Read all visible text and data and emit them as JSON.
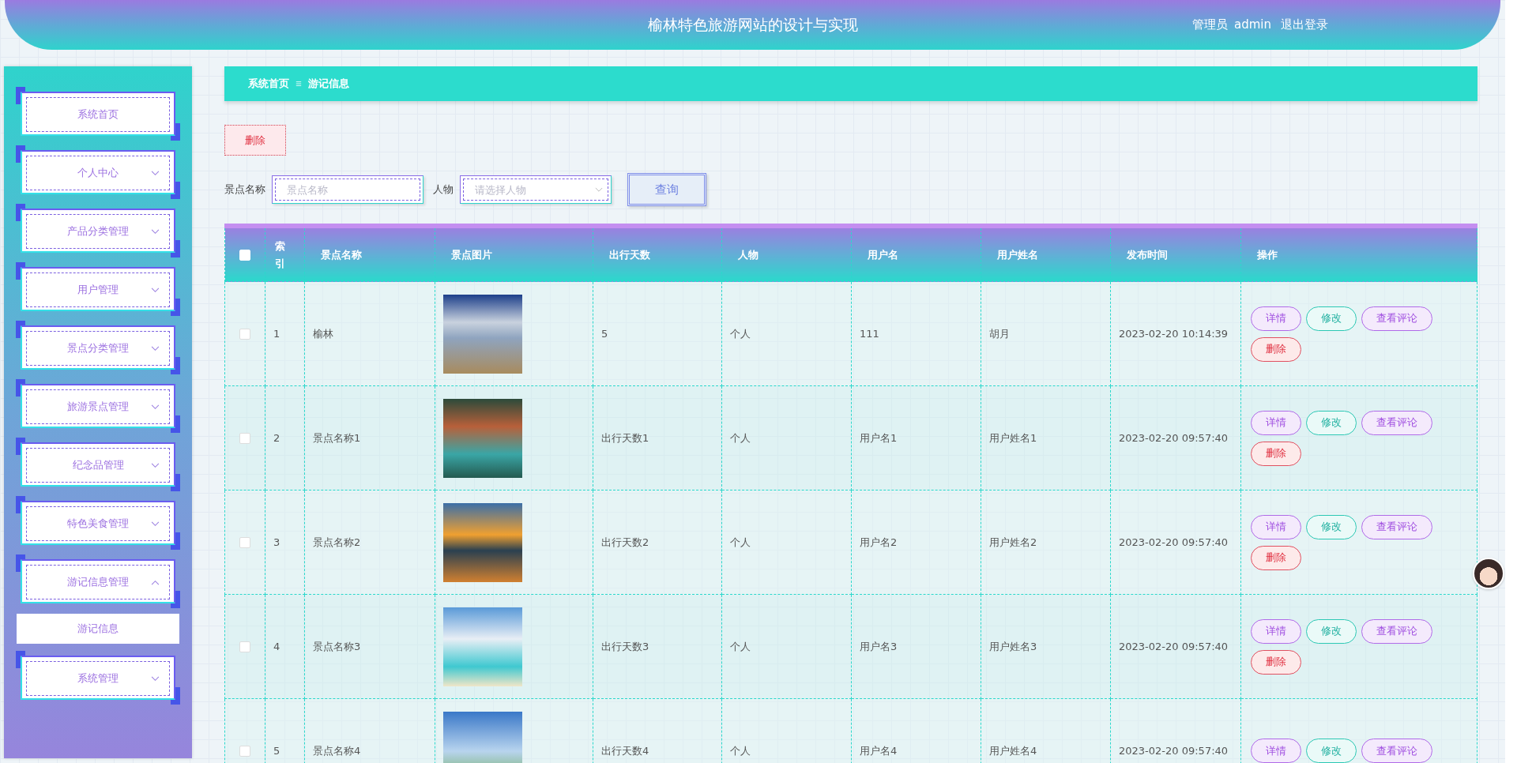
{
  "header": {
    "title": "榆林特色旅游网站的设计与实现",
    "user_role": "管理员",
    "user_name": "admin",
    "logout": "退出登录"
  },
  "sidebar": {
    "items": [
      {
        "label": "系统首页",
        "kind": "link"
      },
      {
        "label": "个人中心",
        "kind": "menu",
        "expanded": false
      },
      {
        "label": "产品分类管理",
        "kind": "menu",
        "expanded": false
      },
      {
        "label": "用户管理",
        "kind": "menu",
        "expanded": false
      },
      {
        "label": "景点分类管理",
        "kind": "menu",
        "expanded": false
      },
      {
        "label": "旅游景点管理",
        "kind": "menu",
        "expanded": false
      },
      {
        "label": "纪念品管理",
        "kind": "menu",
        "expanded": false
      },
      {
        "label": "特色美食管理",
        "kind": "menu",
        "expanded": false
      },
      {
        "label": "游记信息管理",
        "kind": "menu",
        "expanded": true,
        "children": [
          {
            "label": "游记信息",
            "selected": true
          }
        ]
      },
      {
        "label": "系统管理",
        "kind": "menu",
        "expanded": false
      }
    ]
  },
  "breadcrumb": [
    "系统首页",
    "游记信息"
  ],
  "toolbar": {
    "delete_button": "删除"
  },
  "search": {
    "fields": [
      {
        "label": "景点名称",
        "placeholder": "景点名称",
        "kind": "text"
      },
      {
        "label": "人物",
        "placeholder": "请选择人物",
        "kind": "select"
      }
    ],
    "button": "查询"
  },
  "table": {
    "header_checkbox": {
      "checked": false
    },
    "columns": [
      "索引",
      "景点名称",
      "景点图片",
      "出行天数",
      "人物",
      "用户名",
      "用户姓名",
      "发布时间",
      "操作"
    ],
    "rows": [
      {
        "checked": false,
        "index": "1",
        "name": "榆林",
        "days": "5",
        "person": "个人",
        "username": "111",
        "realname": "胡月",
        "time": "2023-02-20 10:14:39",
        "actions": [
          {
            "label": "详情",
            "kind": "detail"
          },
          {
            "label": "修改",
            "kind": "edit"
          },
          {
            "label": "查看评论",
            "kind": "comments"
          },
          {
            "label": "删除",
            "kind": "delete"
          }
        ]
      },
      {
        "checked": false,
        "index": "2",
        "name": "景点名称1",
        "days": "出行天数1",
        "person": "个人",
        "username": "用户名1",
        "realname": "用户姓名1",
        "time": "2023-02-20 09:57:40",
        "actions": [
          {
            "label": "详情",
            "kind": "detail"
          },
          {
            "label": "修改",
            "kind": "edit"
          },
          {
            "label": "查看评论",
            "kind": "comments"
          },
          {
            "label": "删除",
            "kind": "delete"
          }
        ]
      },
      {
        "checked": false,
        "index": "3",
        "name": "景点名称2",
        "days": "出行天数2",
        "person": "个人",
        "username": "用户名2",
        "realname": "用户姓名2",
        "time": "2023-02-20 09:57:40",
        "actions": [
          {
            "label": "详情",
            "kind": "detail"
          },
          {
            "label": "修改",
            "kind": "edit"
          },
          {
            "label": "查看评论",
            "kind": "comments"
          },
          {
            "label": "删除",
            "kind": "delete"
          }
        ]
      },
      {
        "checked": false,
        "index": "4",
        "name": "景点名称3",
        "days": "出行天数3",
        "person": "个人",
        "username": "用户名3",
        "realname": "用户姓名3",
        "time": "2023-02-20 09:57:40",
        "actions": [
          {
            "label": "详情",
            "kind": "detail"
          },
          {
            "label": "修改",
            "kind": "edit"
          },
          {
            "label": "查看评论",
            "kind": "comments"
          },
          {
            "label": "删除",
            "kind": "delete"
          }
        ]
      },
      {
        "checked": false,
        "index": "5",
        "name": "景点名称4",
        "days": "出行天数4",
        "person": "个人",
        "username": "用户名4",
        "realname": "用户姓名4",
        "time": "2023-02-20 09:57:40",
        "actions": [
          {
            "label": "详情",
            "kind": "detail"
          },
          {
            "label": "修改",
            "kind": "edit"
          },
          {
            "label": "查看评论",
            "kind": "comments"
          }
        ]
      }
    ]
  }
}
